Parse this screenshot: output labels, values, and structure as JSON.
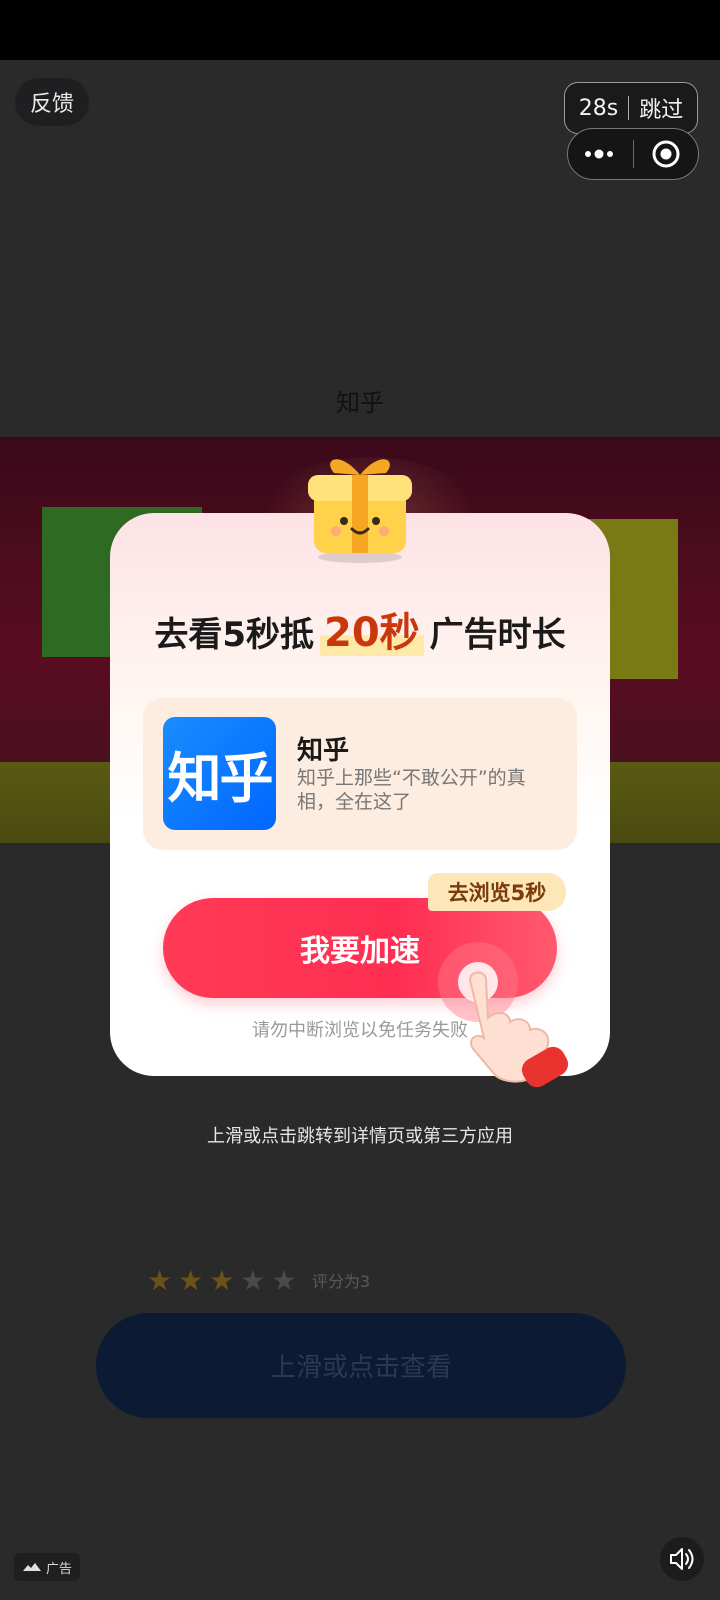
{
  "top": {
    "feedback_label": "反馈",
    "countdown": "28s",
    "skip_label": "跳过"
  },
  "brand": {
    "name": "知乎"
  },
  "dialog": {
    "title_prefix": "去看5秒抵",
    "title_highlight": "20秒",
    "title_suffix": "广告时长",
    "app": {
      "icon_text": "知乎",
      "name": "知乎",
      "description": "知乎上那些“不敢公开”的真相，全在这了"
    },
    "browse_tag": "去浏览5秒",
    "action_label": "我要加速",
    "warning": "请勿中断浏览以免任务失败"
  },
  "page": {
    "jump_hint": "上滑或点击跳转到详情页或第三方应用",
    "rating": 3,
    "rating_max": 5,
    "rating_text": "评分为3",
    "view_label": "上滑或点击查看",
    "ad_label": "广告"
  },
  "colors": {
    "accent_red": "#ff2e52",
    "highlight_orange": "#c8380c",
    "app_blue": "#0066ff"
  }
}
